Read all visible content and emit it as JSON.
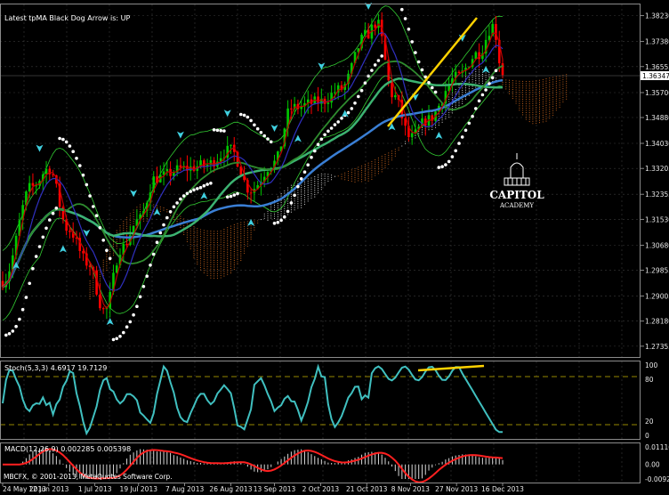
{
  "header": {
    "indicator_text": "Latest tpMA Black Dog Arrow is:  UP"
  },
  "price_panel": {
    "current_price_label": "1.36347",
    "right_tick_labels": [
      "1.38230",
      "1.37380",
      "1.36555",
      "1.35700",
      "1.34880",
      "1.34030",
      "1.33205",
      "1.32355",
      "1.31530",
      "1.30680",
      "1.29855",
      "1.29005",
      "1.28180",
      "1.27355"
    ]
  },
  "logo": {
    "line1": "CAPITOL",
    "line2": "ACADEMY"
  },
  "stoch_panel": {
    "label": "Stoch(5,3,3) 4.6917 19.7129",
    "right_tick_labels": [
      "100",
      "80",
      "20",
      "0"
    ]
  },
  "macd_panel": {
    "label": "MACD(12,26,9) 0.002285 0.005398",
    "right_tick_labels": [
      "0.01116",
      "0.00",
      "-0.00927"
    ]
  },
  "footer": {
    "copyright": "MBCFX, © 2001-2013, MetaQuotes Software Corp.",
    "date_labels": [
      "24 May 2013",
      "12 Jun 2013",
      "1 Jul 2013",
      "19 Jul 2013",
      "7 Aug 2013",
      "26 Aug 2013",
      "13 Sep 2013",
      "2 Oct 2013",
      "21 Oct 2013",
      "8 Nov 2013",
      "27 Nov 2013",
      "16 Dec 2013"
    ]
  },
  "colors": {
    "bull_candle": "#00c800",
    "bear_candle": "#ff0000",
    "sma_slow": "#3a7fd5",
    "sma_mid": "#3cb371",
    "sma_fast": "#2e8b2e",
    "envelope": "#32cd32",
    "stoch": "#40c0c0",
    "macd": "#ff2020",
    "trendline": "#ffd200",
    "arrow": "#40d0e0",
    "cloud": "#d2691e"
  },
  "chart_data": [
    {
      "type": "candlestick",
      "title": "",
      "x_range": [
        "24 May 2013",
        "16 Dec 2013"
      ],
      "ylim": [
        1.27,
        1.386
      ],
      "last_price": 1.36347,
      "overlays": [
        "Ichimoku cloud",
        "moving averages",
        "parabolic SAR dots",
        "arrows"
      ],
      "anchor_closes": [
        [
          "24 May 2013",
          1.295
        ],
        [
          "5 Jun 2013",
          1.326
        ],
        [
          "12 Jun 2013",
          1.332
        ],
        [
          "20 Jun 2013",
          1.312
        ],
        [
          "28 Jun 2013",
          1.301
        ],
        [
          "5 Jul 2013",
          1.285
        ],
        [
          "12 Jul 2013",
          1.306
        ],
        [
          "19 Jul 2013",
          1.315
        ],
        [
          "26 Jul 2013",
          1.329
        ],
        [
          "7 Aug 2013",
          1.332
        ],
        [
          "15 Aug 2013",
          1.333
        ],
        [
          "26 Aug 2013",
          1.338
        ],
        [
          "3 Sep 2013",
          1.325
        ],
        [
          "13 Sep 2013",
          1.334
        ],
        [
          "20 Sep 2013",
          1.352
        ],
        [
          "2 Oct 2013",
          1.354
        ],
        [
          "10 Oct 2013",
          1.358
        ],
        [
          "21 Oct 2013",
          1.376
        ],
        [
          "25 Oct 2013",
          1.38
        ],
        [
          "1 Nov 2013",
          1.356
        ],
        [
          "8 Nov 2013",
          1.342
        ],
        [
          "15 Nov 2013",
          1.348
        ],
        [
          "27 Nov 2013",
          1.362
        ],
        [
          "6 Dec 2013",
          1.37
        ],
        [
          "12 Dec 2013",
          1.379
        ],
        [
          "16 Dec 2013",
          1.3635
        ]
      ]
    },
    {
      "type": "line",
      "title": "Stoch(5,3,3)",
      "ylim": [
        0,
        100
      ],
      "levels": [
        20,
        80
      ],
      "last_values": {
        "main": 4.6917,
        "signal": 19.7129
      }
    },
    {
      "type": "histogram",
      "title": "MACD(12,26,9)",
      "ylim": [
        -0.00927,
        0.01116
      ],
      "last_values": {
        "main": 0.002285,
        "signal": 0.005398
      }
    }
  ]
}
